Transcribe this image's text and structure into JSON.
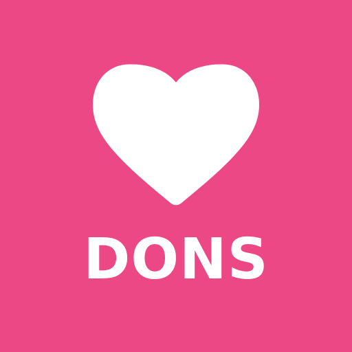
{
  "tile": {
    "background_color": "#ec4886",
    "foreground_color": "#ffffff"
  },
  "icon": {
    "name": "heart-icon"
  },
  "label": {
    "text": "DONS"
  }
}
